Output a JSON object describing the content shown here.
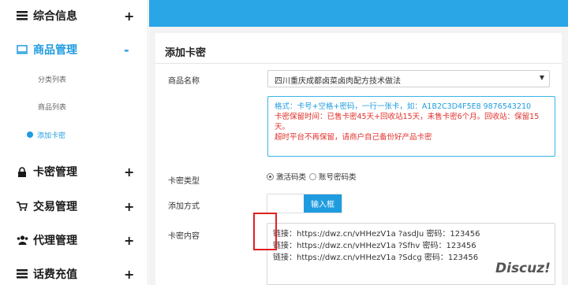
{
  "sidebar": {
    "items": [
      {
        "label": "综合信息",
        "toggle": "+",
        "icon": "list-icon"
      },
      {
        "label": "商品管理",
        "toggle": "-",
        "icon": "monitor-icon"
      },
      {
        "label": "卡密管理",
        "toggle": "+",
        "icon": "lock-icon"
      },
      {
        "label": "交易管理",
        "toggle": "+",
        "icon": "cart-icon"
      },
      {
        "label": "代理管理",
        "toggle": "+",
        "icon": "users-icon"
      },
      {
        "label": "话费充值",
        "toggle": "+",
        "icon": "list-icon"
      }
    ],
    "sub_items": [
      "分类列表",
      "商品列表",
      "添加卡密"
    ]
  },
  "page": {
    "title": "添加卡密",
    "product_label": "商品名称",
    "product_value": "四川重庆成都卤菜卤肉配方技术做法",
    "hint_line1": "格式：卡号+空格+密码，一行一张卡，如：A1B2C3D4F5E8 9876543210",
    "hint_line2": "卡密保留时间：已售卡密45天+回收站15天，未售卡密6个月。回收站：保留15天。",
    "hint_line3": "超时平台不再保留，请商户自己备份好产品卡密",
    "type_label": "卡密类型",
    "type_option1": "激活码类",
    "type_option2": "账号密码类",
    "add_label": "添加方式",
    "add_button": "输入框",
    "content_label": "卡密内容",
    "content_lines": [
      "链接：https://dwz.cn/vHHezV1a ?asdJu 密码：123456",
      "链接：https://dwz.cn/vHHezV1a ?Sfhv 密码：123456",
      "链接：https://dwz.cn/vHHezV1a ?Sdcg 密码：123456"
    ]
  },
  "watermark": "Discuz!",
  "colors": {
    "accent": "#1f9ce0",
    "topbar": "#2aa5e6",
    "warning": "#e0302a"
  }
}
